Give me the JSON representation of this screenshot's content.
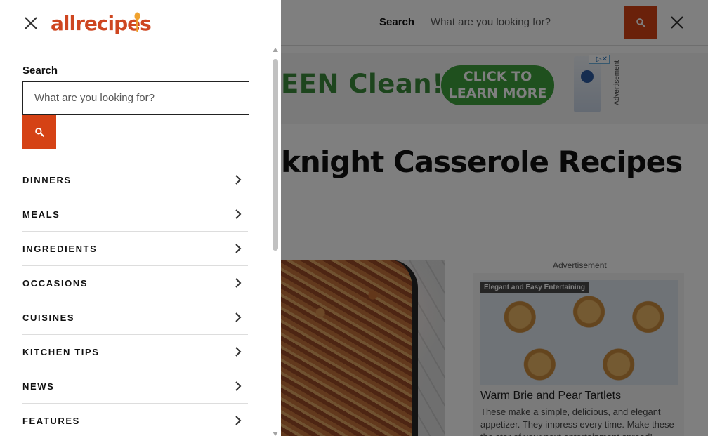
{
  "page": {
    "header": {
      "search_label": "Search",
      "search_placeholder": "What are you looking for?"
    },
    "ad_banner": {
      "text": "EEN Clean!",
      "cta": "CLICK TO LEARN MORE",
      "label": "Advertisement"
    },
    "title": "knight Casserole Recipes",
    "side_ad": {
      "label": "Advertisement",
      "tag": "Elegant and Easy Entertaining",
      "title": "Warm Brie and Pear Tartlets",
      "description": "These make a simple, delicious, and elegant appetizer. They impress every time. Make these the star of your next entertainment spread!"
    }
  },
  "drawer": {
    "logo": "allrecipes",
    "search_label": "Search",
    "search_placeholder": "What are you looking for?",
    "nav": [
      {
        "label": "DINNERS"
      },
      {
        "label": "MEALS"
      },
      {
        "label": "INGREDIENTS"
      },
      {
        "label": "OCCASIONS"
      },
      {
        "label": "CUISINES"
      },
      {
        "label": "KITCHEN TIPS"
      },
      {
        "label": "NEWS"
      },
      {
        "label": "FEATURES"
      }
    ]
  },
  "icons": {
    "close": "close-icon",
    "search": "search-icon",
    "chevron": "chevron-right-icon"
  },
  "colors": {
    "brand": "#ce4620",
    "search_button": "#d54215",
    "ad_green": "#3fa13c"
  }
}
